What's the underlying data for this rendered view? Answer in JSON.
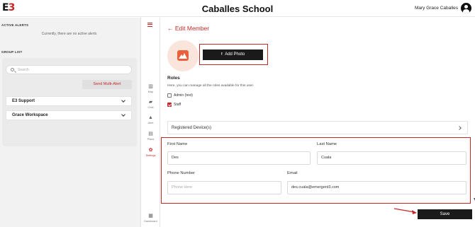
{
  "header": {
    "logo_text": "E",
    "logo_accent": "3",
    "school_name": "Caballes School",
    "user_name": "Mary Grace Caballes",
    "avatar_icon": "account-circle-icon"
  },
  "alerts_panel": {
    "active_alerts_label": "ACTIVE ALERTS",
    "no_alerts_text": "Currently, there are no active alerts",
    "group_list_label": "GROUP LIST",
    "search_placeholder": "Search",
    "send_multi_alert_label": "Send Multi-Alert",
    "groups": [
      {
        "name": "E3 Support"
      },
      {
        "name": "Grace Workspace"
      }
    ]
  },
  "nav": {
    "items": [
      {
        "label": "Map",
        "icon": "map-icon"
      },
      {
        "label": "Chat",
        "icon": "chat-icon"
      },
      {
        "label": "Alert",
        "icon": "alert-icon"
      },
      {
        "label": "Plans",
        "icon": "plans-icon"
      },
      {
        "label": "Settings",
        "icon": "gear-icon",
        "active": true
      },
      {
        "label": "Dashboard",
        "icon": "dashboard-icon"
      }
    ]
  },
  "edit_member": {
    "back_label": "← Edit Member",
    "add_photo_label": "Add Photo",
    "roles_title": "Roles",
    "roles_desc": "Here, you can manage all the roles available for this user.",
    "roles": [
      {
        "label": "Admin (text)",
        "checked": false
      },
      {
        "label": "Staff",
        "checked": true
      }
    ],
    "registered_devices_label": "Registered Device(s)",
    "first_name_label": "First Name",
    "first_name_value": "Des",
    "last_name_label": "Last Name",
    "last_name_value": "Cuala",
    "phone_label": "Phone Number",
    "phone_placeholder": "Phone Here",
    "email_label": "Email",
    "email_value": "des.cuala@emergent3.com",
    "save_label": "Save"
  },
  "colors": {
    "accent": "#c62828",
    "button_dark": "#1a1a1a",
    "photo_bg": "#f9e5dc",
    "photo_icon": "#e8603c"
  }
}
